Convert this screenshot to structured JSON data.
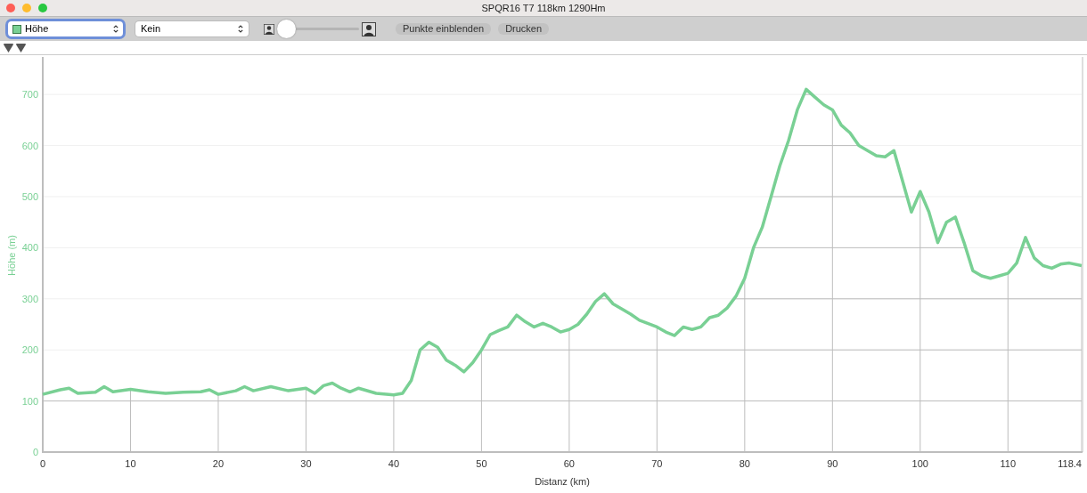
{
  "window": {
    "title": "SPQR16 T7 118km 1290Hm"
  },
  "toolbar": {
    "metric_select": {
      "value": "Höhe"
    },
    "compare_select": {
      "value": "Kein"
    },
    "zoom_slider": {
      "level": 0
    },
    "buttons": [
      "Punkte einblenden",
      "Drucken"
    ]
  },
  "chart": {
    "chart_data": {
      "type": "line",
      "xlabel": "Distanz (km)",
      "ylabel": "Höhe (m)",
      "x": [
        0,
        2,
        3,
        4,
        6,
        7,
        8,
        10,
        12,
        14,
        16,
        18,
        19,
        20,
        22,
        23,
        24,
        26,
        28,
        30,
        31,
        32,
        33,
        34,
        35,
        36,
        38,
        40,
        41,
        42,
        43,
        44,
        45,
        46,
        47,
        48,
        49,
        50,
        51,
        52,
        53,
        54,
        55,
        56,
        57,
        58,
        59,
        60,
        61,
        62,
        63,
        64,
        65,
        66,
        67,
        68,
        70,
        71,
        72,
        73,
        74,
        75,
        76,
        77,
        78,
        79,
        80,
        81,
        82,
        83,
        84,
        85,
        86,
        87,
        88,
        89,
        90,
        91,
        92,
        93,
        94,
        95,
        96,
        97,
        98,
        99,
        100,
        101,
        102,
        103,
        104,
        105,
        106,
        107,
        108,
        109,
        110,
        111,
        112,
        113,
        114,
        115,
        116,
        117,
        118.4
      ],
      "grid": true,
      "series": [
        {
          "color": "#79d094",
          "values": [
            113,
            122,
            125,
            115,
            117,
            128,
            118,
            123,
            118,
            115,
            117,
            118,
            122,
            113,
            120,
            128,
            120,
            128,
            120,
            125,
            115,
            130,
            135,
            125,
            118,
            125,
            115,
            112,
            115,
            140,
            200,
            215,
            205,
            180,
            170,
            157,
            175,
            200,
            230,
            238,
            245,
            268,
            255,
            245,
            252,
            245,
            235,
            240,
            250,
            270,
            295,
            310,
            290,
            280,
            270,
            258,
            245,
            235,
            228,
            245,
            240,
            245,
            263,
            268,
            282,
            305,
            340,
            400,
            440,
            500,
            560,
            610,
            670,
            710,
            695,
            680,
            670,
            640,
            625,
            600,
            590,
            580,
            578,
            590,
            530,
            470,
            510,
            470,
            410,
            450,
            460,
            410,
            355,
            345,
            340,
            345,
            350,
            370,
            420,
            380,
            365,
            360,
            368,
            370,
            365
          ]
        }
      ],
      "xlim": [
        0,
        118.4
      ],
      "ylim": [
        0,
        770
      ],
      "xticks": [
        0,
        10,
        20,
        30,
        40,
        50,
        60,
        70,
        80,
        90,
        100,
        110,
        {
          "value": 118.4,
          "label": "118.4"
        }
      ],
      "yticks": [
        0,
        100,
        200,
        300,
        400,
        500,
        600,
        700
      ]
    }
  }
}
